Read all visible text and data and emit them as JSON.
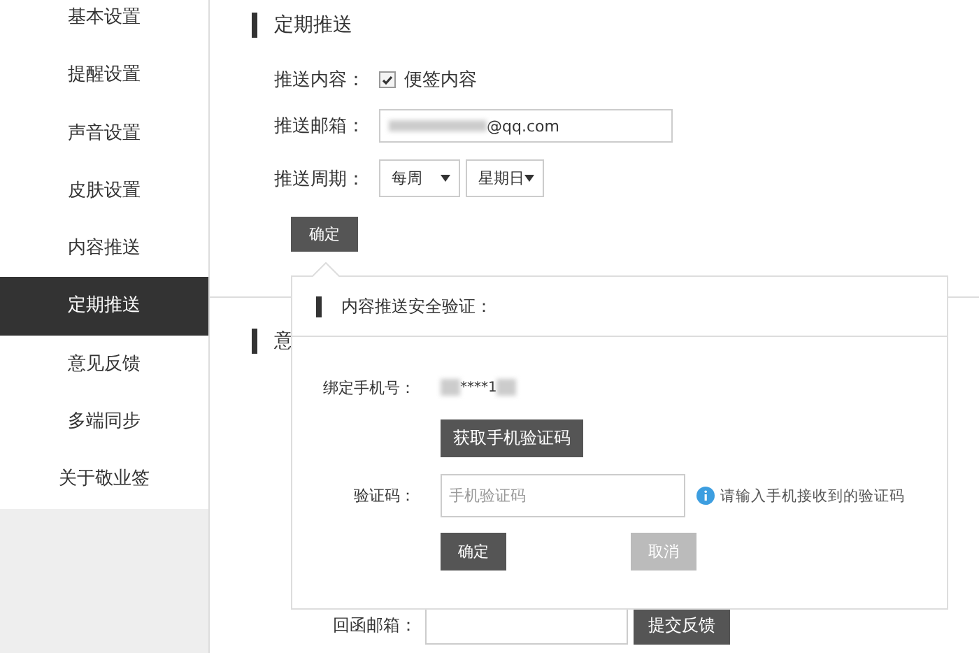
{
  "sidebar": {
    "items": [
      {
        "label": "基本设置",
        "selected": false
      },
      {
        "label": "提醒设置",
        "selected": false
      },
      {
        "label": "声音设置",
        "selected": false
      },
      {
        "label": "皮肤设置",
        "selected": false
      },
      {
        "label": "内容推送",
        "selected": false
      },
      {
        "label": "定期推送",
        "selected": true
      },
      {
        "label": "意见反馈",
        "selected": false
      },
      {
        "label": "多端同步",
        "selected": false
      },
      {
        "label": "关于敬业签",
        "selected": false
      }
    ]
  },
  "schedule": {
    "title": "定期推送",
    "content_label": "推送内容：",
    "content_option": {
      "label": "便签内容",
      "checked": true
    },
    "email_label": "推送邮箱：",
    "email_value": "@qq.com",
    "period_label": "推送周期：",
    "period_selects": [
      "每周",
      "星期日"
    ],
    "confirm": "确定"
  },
  "feedback": {
    "title": "意",
    "reply_email_label": "回函邮箱：",
    "submit": "提交反馈"
  },
  "popup": {
    "title": "内容推送安全验证：",
    "phone_label": "绑定手机号：",
    "phone_value": "****1",
    "get_code": "获取手机验证码",
    "code_label": "验证码：",
    "code_placeholder": "手机验证码",
    "hint": "请输入手机接收到的验证码",
    "confirm": "确定",
    "cancel": "取消"
  }
}
